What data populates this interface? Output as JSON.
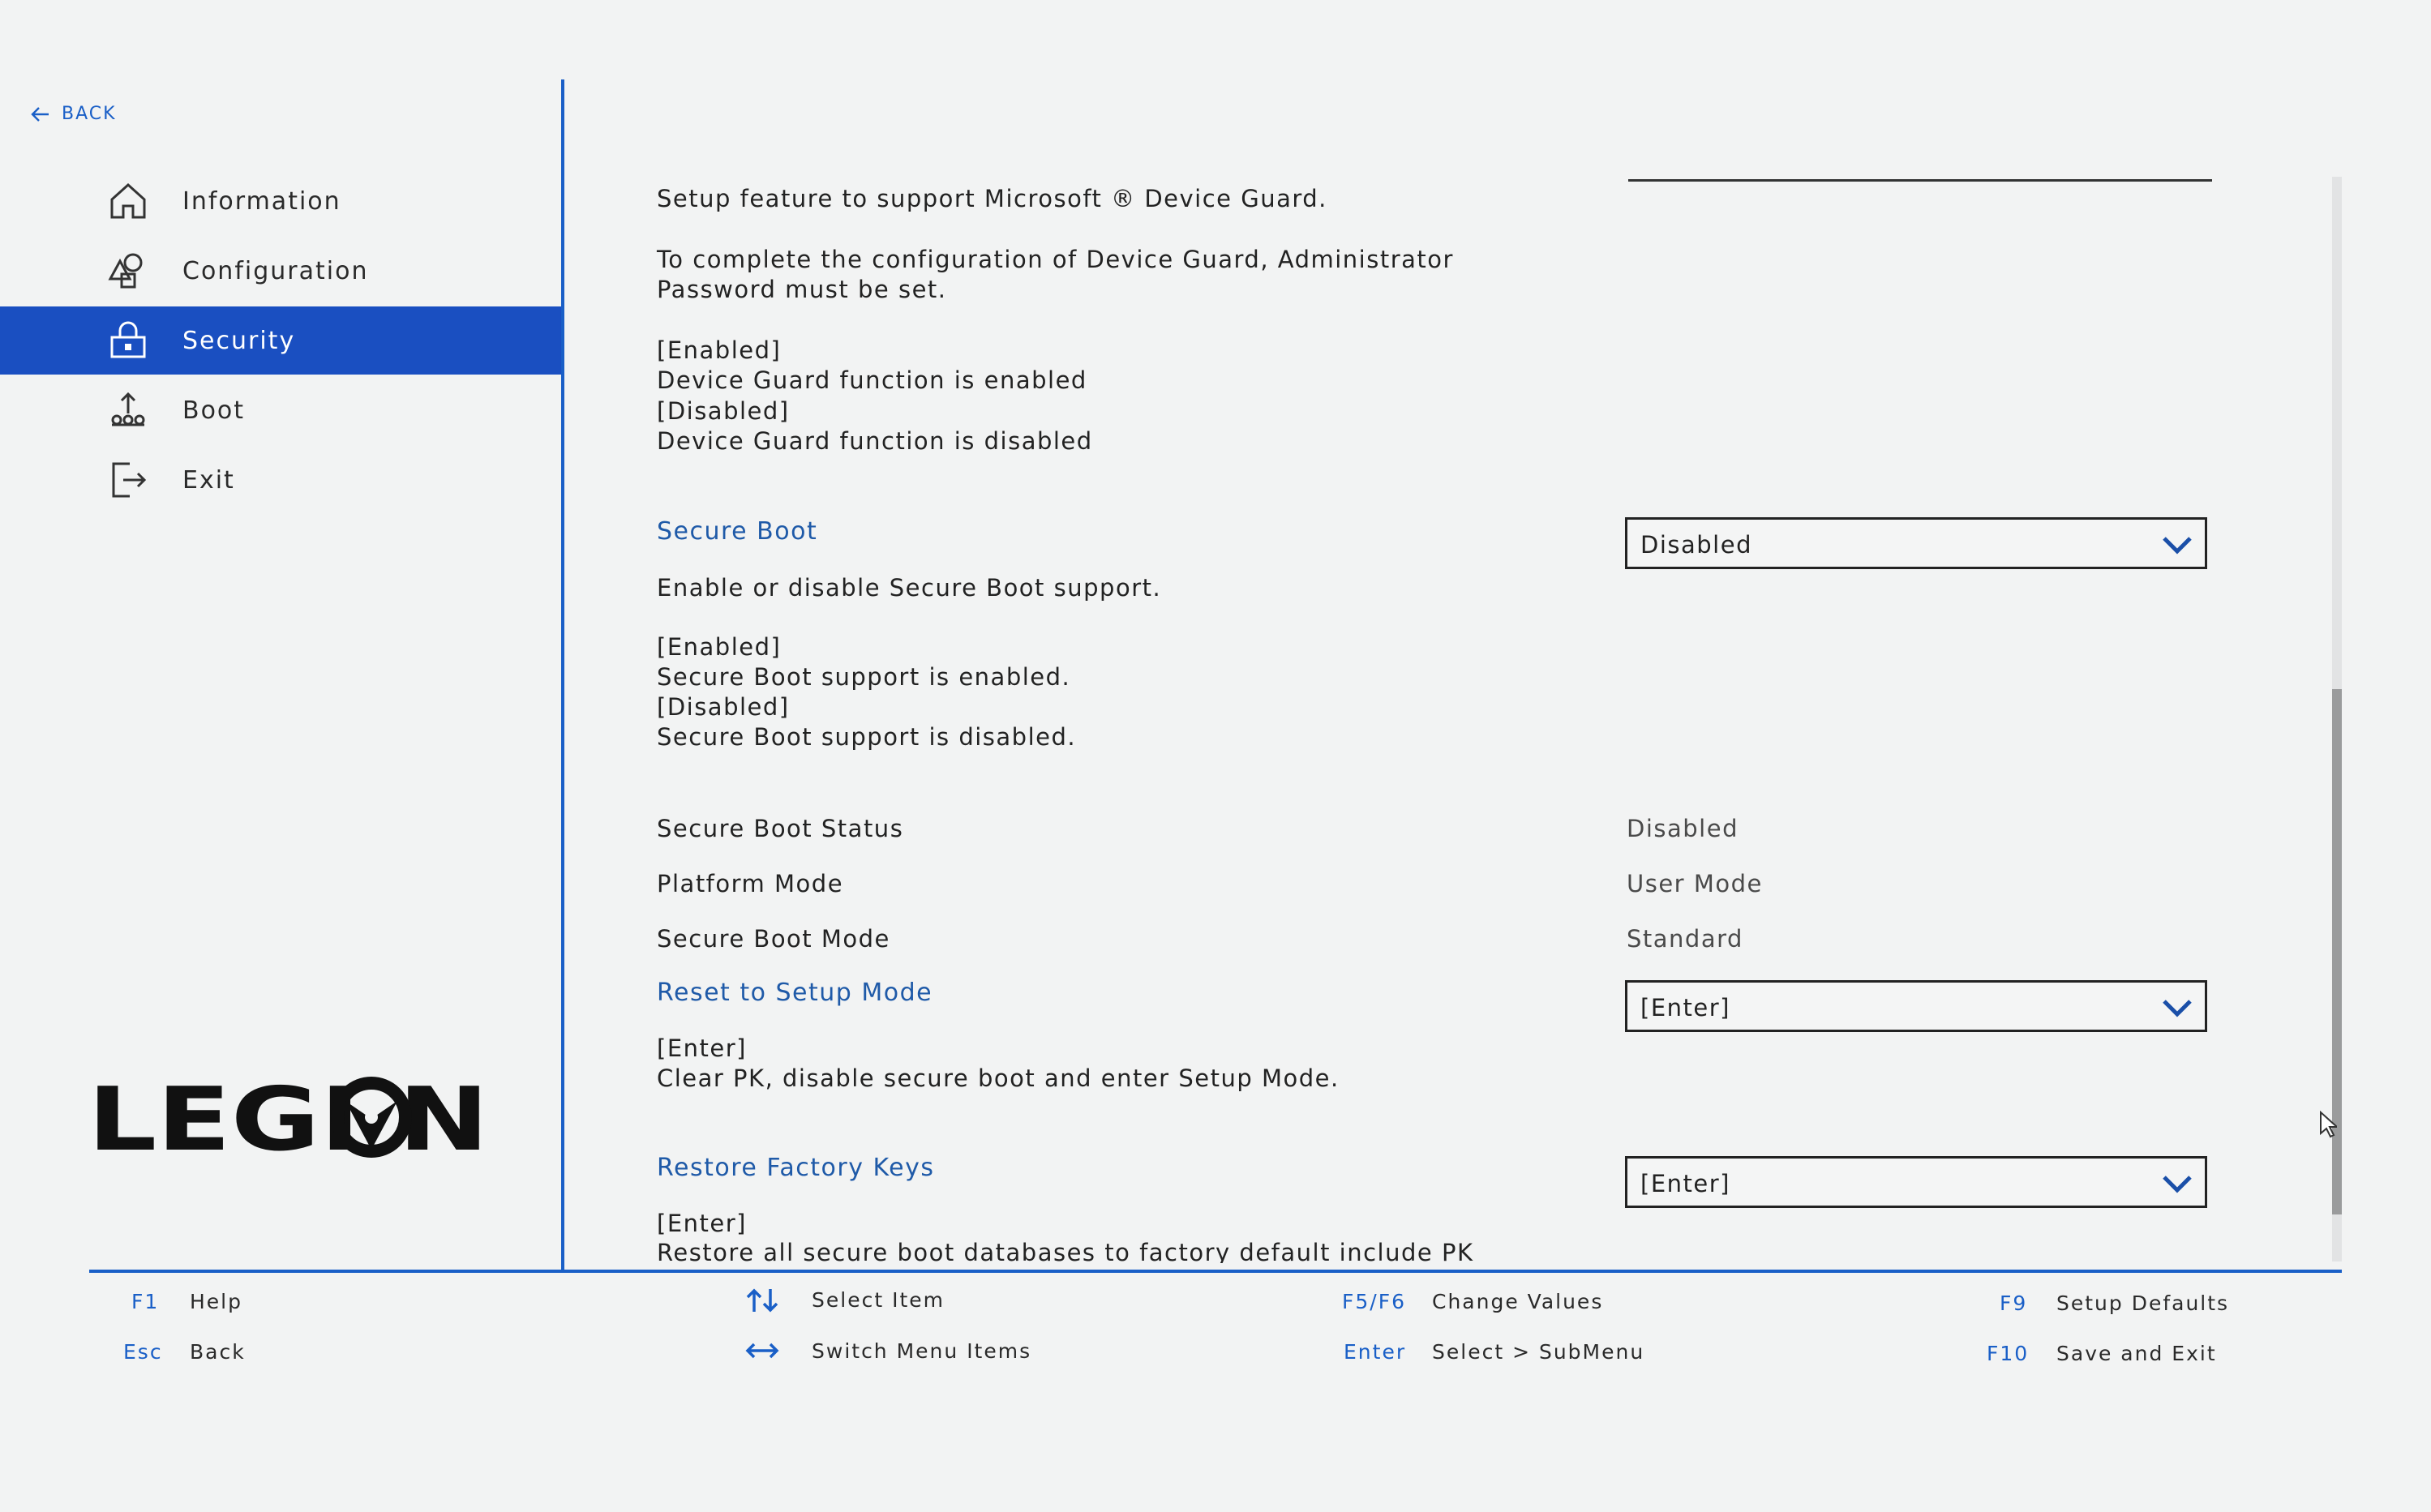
{
  "sidebar": {
    "back_label": "BACK",
    "items": [
      {
        "label": "Information",
        "icon": "home-icon"
      },
      {
        "label": "Configuration",
        "icon": "shapes-icon"
      },
      {
        "label": "Security",
        "icon": "lock-icon",
        "active": true
      },
      {
        "label": "Boot",
        "icon": "boot-icon"
      },
      {
        "label": "Exit",
        "icon": "exit-icon"
      }
    ],
    "logo_text": "LEGION"
  },
  "content": {
    "device_guard": {
      "desc1": "Setup feature to support Microsoft ® Device Guard.",
      "desc2": "To complete the configuration of Device Guard, Administrator",
      "desc3": "Password must be set.",
      "opt1": "[Enabled]",
      "opt1_desc": "Device Guard function is enabled",
      "opt2": "[Disabled]",
      "opt2_desc": "Device Guard function is disabled"
    },
    "secure_boot": {
      "label": "Secure Boot",
      "value": "Disabled",
      "desc": "Enable or disable Secure Boot support.",
      "opt1": "[Enabled]",
      "opt1_desc": "Secure Boot support is enabled.",
      "opt2": "[Disabled]",
      "opt2_desc": "Secure Boot support is disabled."
    },
    "status_rows": [
      {
        "label": "Secure Boot Status",
        "value": "Disabled"
      },
      {
        "label": "Platform Mode",
        "value": "User Mode"
      },
      {
        "label": "Secure Boot Mode",
        "value": "Standard"
      }
    ],
    "reset_setup": {
      "label": "Reset to Setup Mode",
      "value": "[Enter]",
      "opt": "[Enter]",
      "opt_desc": "Clear PK, disable secure boot and enter Setup Mode."
    },
    "restore_keys": {
      "label": "Restore Factory Keys",
      "value": "[Enter]",
      "opt": "[Enter]",
      "opt_desc": "Restore all secure boot databases to factory default include PK"
    }
  },
  "footer": {
    "f1_key": "F1",
    "f1_desc": "Help",
    "esc_key": "Esc",
    "esc_desc": "Back",
    "select_item": "Select Item",
    "switch_menu": "Switch Menu Items",
    "f5f6_key": "F5/F6",
    "f5f6_desc": "Change Values",
    "enter_key": "Enter",
    "enter_desc": "Select > SubMenu",
    "f9_key": "F9",
    "f9_desc": "Setup Defaults",
    "f10_key": "F10",
    "f10_desc": "Save and Exit"
  },
  "colors": {
    "accent": "#1a4fc1",
    "link": "#1f5aa8"
  }
}
